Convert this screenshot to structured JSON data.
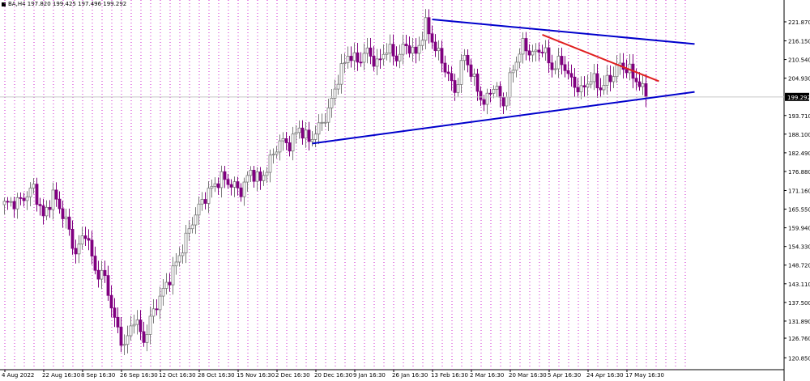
{
  "header": {
    "text": "BA,H4  197.820 199.425 197.496 199.292"
  },
  "colors": {
    "grid": "#cc22cc",
    "bear": "#800080",
    "bull": "#7a7a7a",
    "trend_blue": "#0000cc",
    "trend_red": "#e02020",
    "price_line": "#c8c8c8",
    "badge": "#000000"
  },
  "chart_data": {
    "type": "candlestick",
    "symbol": "BA",
    "timeframe": "H4",
    "last": {
      "open": 197.82,
      "high": 199.425,
      "low": 197.496,
      "close": 199.292
    },
    "current_price": 199.292,
    "current_price_label": "199.292",
    "y_ticks": [
      "221.870",
      "216.150",
      "210.540",
      "204.930",
      "199.292",
      "193.710",
      "188.100",
      "182.490",
      "176.880",
      "171.160",
      "165.550",
      "159.940",
      "154.330",
      "148.720",
      "143.110",
      "137.500",
      "131.890",
      "126.760",
      "120.850"
    ],
    "y_tick_values": [
      221.87,
      216.15,
      210.54,
      204.93,
      199.292,
      193.71,
      188.1,
      182.49,
      176.88,
      171.16,
      165.55,
      159.94,
      154.33,
      148.72,
      143.11,
      137.5,
      131.89,
      126.76,
      120.85
    ],
    "ylim": [
      118.5,
      226.0
    ],
    "x_tick_labels": [
      "4 Aug 2022",
      "22 Aug 16:30",
      "8 Sep 16:30",
      "26 Sep 16:30",
      "12 Oct 16:30",
      "28 Oct 16:30",
      "15 Nov 16:30",
      "2 Dec 16:30",
      "20 Dec 16:30",
      "9 Jan 16:30",
      "26 Jan 16:30",
      "13 Feb 16:30",
      "2 Mar 16:30",
      "20 Mar 16:30",
      "5 Apr 16:30",
      "24 Apr 16:30",
      "17 May 16:30"
    ],
    "x_tick_index": [
      0,
      12,
      24,
      36,
      48,
      60,
      72,
      84,
      96,
      108,
      120,
      132,
      144,
      156,
      168,
      180,
      192
    ],
    "bar_count": 199,
    "vertical_grid_every": 3,
    "anchors": [
      [
        0,
        167
      ],
      [
        5,
        168
      ],
      [
        9,
        172
      ],
      [
        12,
        163
      ],
      [
        15,
        170
      ],
      [
        19,
        162
      ],
      [
        22,
        152
      ],
      [
        25,
        159
      ],
      [
        28,
        147
      ],
      [
        31,
        145
      ],
      [
        34,
        132
      ],
      [
        37,
        124
      ],
      [
        40,
        133
      ],
      [
        43,
        126
      ],
      [
        46,
        135
      ],
      [
        49,
        141
      ],
      [
        52,
        147
      ],
      [
        55,
        154
      ],
      [
        58,
        162
      ],
      [
        61,
        168
      ],
      [
        64,
        172
      ],
      [
        67,
        175
      ],
      [
        70,
        173
      ],
      [
        73,
        171
      ],
      [
        76,
        177
      ],
      [
        79,
        174
      ],
      [
        82,
        180
      ],
      [
        85,
        186
      ],
      [
        88,
        185
      ],
      [
        91,
        190
      ],
      [
        94,
        186
      ],
      [
        97,
        190
      ],
      [
        100,
        195
      ],
      [
        103,
        205
      ],
      [
        106,
        212
      ],
      [
        109,
        210
      ],
      [
        112,
        213
      ],
      [
        115,
        209
      ],
      [
        118,
        214
      ],
      [
        121,
        211
      ],
      [
        124,
        215
      ],
      [
        127,
        212
      ],
      [
        130,
        221
      ],
      [
        133,
        214
      ],
      [
        136,
        208
      ],
      [
        139,
        201
      ],
      [
        142,
        212
      ],
      [
        145,
        204
      ],
      [
        148,
        197
      ],
      [
        151,
        203
      ],
      [
        154,
        197
      ],
      [
        157,
        208
      ],
      [
        160,
        215
      ],
      [
        163,
        212
      ],
      [
        166,
        214
      ],
      [
        169,
        208
      ],
      [
        172,
        210
      ],
      [
        175,
        204
      ],
      [
        178,
        201
      ],
      [
        181,
        205
      ],
      [
        184,
        202
      ],
      [
        187,
        205
      ],
      [
        190,
        209
      ],
      [
        193,
        207
      ],
      [
        196,
        203
      ],
      [
        198,
        199.3
      ]
    ],
    "annotations": [
      {
        "type": "trendline",
        "color": "blue",
        "from": [
          132,
          222.6
        ],
        "to": [
          213,
          215.2
        ]
      },
      {
        "type": "trendline",
        "color": "blue",
        "from": [
          95,
          185.3
        ],
        "to": [
          213,
          200.8
        ]
      },
      {
        "type": "trendline",
        "color": "red",
        "from": [
          166,
          218.0
        ],
        "to": [
          202,
          204.0
        ]
      }
    ]
  }
}
